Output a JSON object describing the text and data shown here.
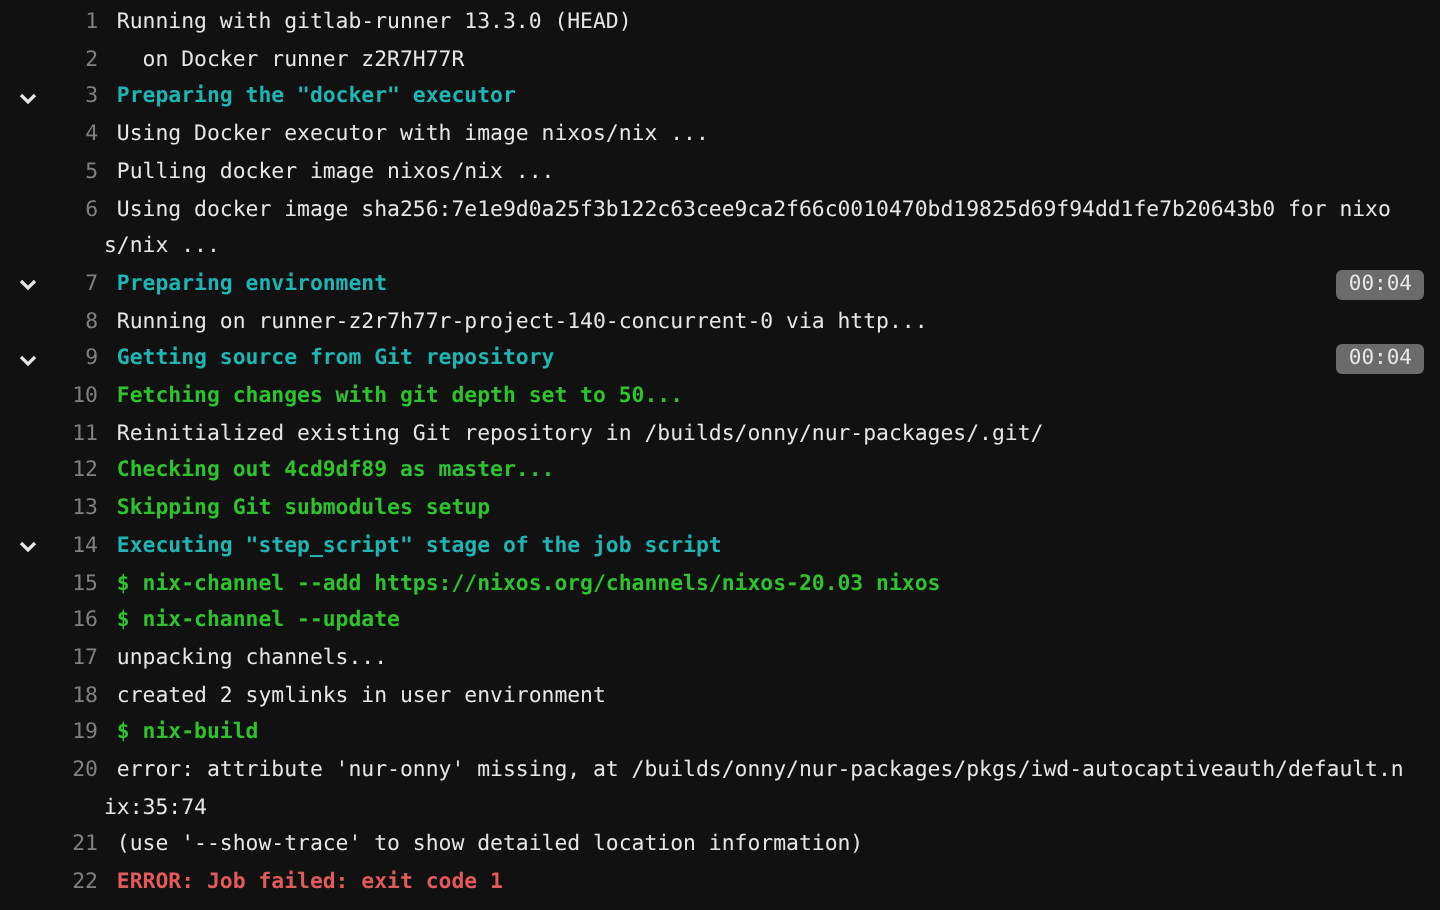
{
  "log_lines": [
    {
      "number": "1",
      "text": "Running with gitlab-runner 13.3.0 (HEAD)",
      "kind": "plain"
    },
    {
      "number": "2",
      "text": "  on Docker runner z2R7H77R",
      "kind": "plain"
    },
    {
      "number": "3",
      "text": "Preparing the \"docker\" executor",
      "kind": "section",
      "expanded": true
    },
    {
      "number": "4",
      "text": "Using Docker executor with image nixos/nix ...",
      "kind": "plain"
    },
    {
      "number": "5",
      "text": "Pulling docker image nixos/nix ...",
      "kind": "plain"
    },
    {
      "number": "6",
      "text": "Using docker image sha256:7e1e9d0a25f3b122c63cee9ca2f66c0010470bd19825d69f94dd1fe7b20643b0 for nixos/nix ...",
      "kind": "plain"
    },
    {
      "number": "7",
      "text": "Preparing environment",
      "kind": "section",
      "expanded": true,
      "duration": "00:04"
    },
    {
      "number": "8",
      "text": "Running on runner-z2r7h77r-project-140-concurrent-0 via http...",
      "kind": "plain"
    },
    {
      "number": "9",
      "text": "Getting source from Git repository",
      "kind": "section",
      "expanded": true,
      "duration": "00:04"
    },
    {
      "number": "10",
      "text": "Fetching changes with git depth set to 50...",
      "kind": "success"
    },
    {
      "number": "11",
      "text": "Reinitialized existing Git repository in /builds/onny/nur-packages/.git/",
      "kind": "plain"
    },
    {
      "number": "12",
      "text": "Checking out 4cd9df89 as master...",
      "kind": "success"
    },
    {
      "number": "13",
      "text": "Skipping Git submodules setup",
      "kind": "success"
    },
    {
      "number": "14",
      "text": "Executing \"step_script\" stage of the job script",
      "kind": "section",
      "expanded": true
    },
    {
      "number": "15",
      "text": "$ nix-channel --add https://nixos.org/channels/nixos-20.03 nixos",
      "kind": "success"
    },
    {
      "number": "16",
      "text": "$ nix-channel --update",
      "kind": "success"
    },
    {
      "number": "17",
      "text": "unpacking channels...",
      "kind": "plain"
    },
    {
      "number": "18",
      "text": "created 2 symlinks in user environment",
      "kind": "plain"
    },
    {
      "number": "19",
      "text": "$ nix-build",
      "kind": "success"
    },
    {
      "number": "20",
      "text": "error: attribute 'nur-onny' missing, at /builds/onny/nur-packages/pkgs/iwd-autocaptiveauth/default.nix:35:74",
      "kind": "plain"
    },
    {
      "number": "21",
      "text": "(use '--show-trace' to show detailed location information)",
      "kind": "plain"
    },
    {
      "number": "22",
      "text": "ERROR: Job failed: exit code 1",
      "kind": "error"
    }
  ]
}
